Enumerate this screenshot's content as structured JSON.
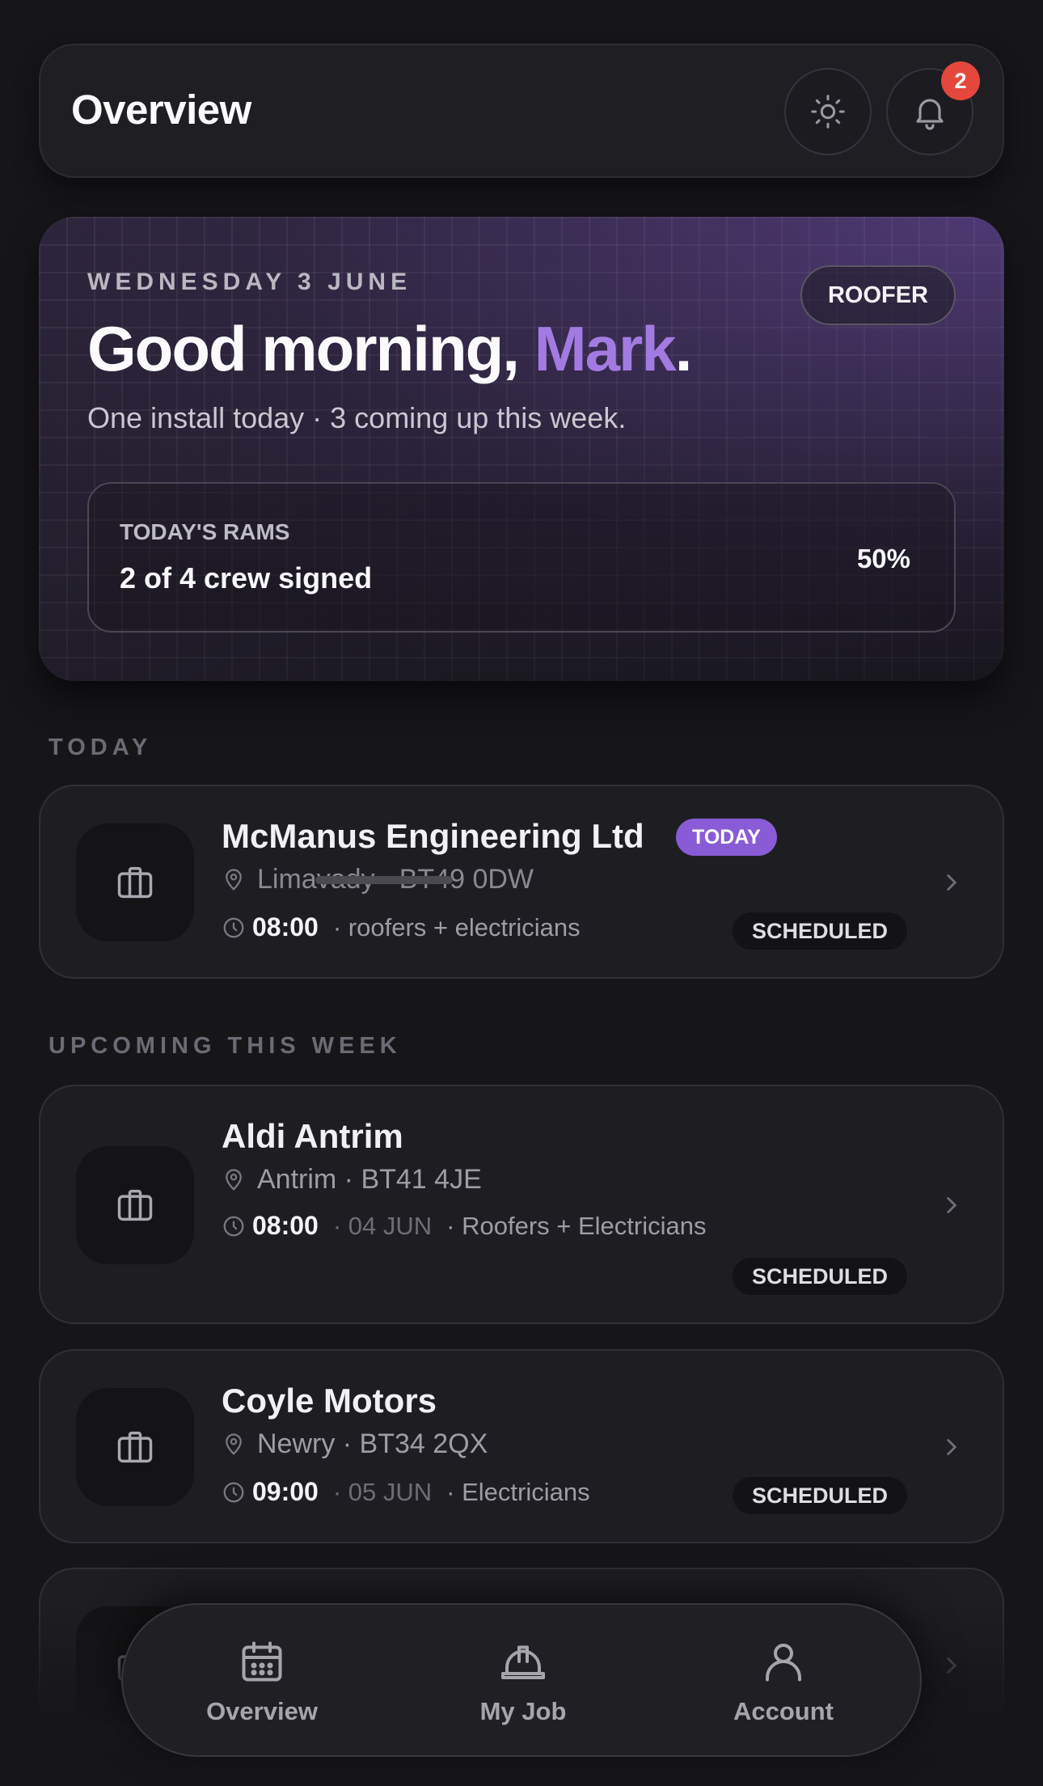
{
  "header": {
    "title": "Overview",
    "notification_count": "2",
    "icons": [
      "sun-icon",
      "bell-icon"
    ]
  },
  "hero": {
    "date": "WEDNESDAY 3 JUNE",
    "role": "ROOFER",
    "greeting_prefix": "Good morning, ",
    "name": "Mark",
    "greeting_suffix": ".",
    "summary": "One install today · 3 coming up this week.",
    "rams": {
      "label": "TODAY'S RAMS",
      "status": "2 of 4 crew signed",
      "percent": "50%"
    },
    "accent_color": "#a27be2"
  },
  "sections": {
    "today": "TODAY",
    "upcoming": "UPCOMING THIS WEEK"
  },
  "jobs": {
    "today": [
      {
        "name": "McManus Engineering Ltd",
        "pill": "TODAY",
        "location": "Limavady · BT49 0DW",
        "time": "08:00",
        "trades": "· roofers + electricians",
        "status": "SCHEDULED"
      }
    ],
    "upcoming": [
      {
        "name": "Aldi Antrim",
        "location": "Antrim · BT41 4JE",
        "time": "08:00",
        "date": "· 04 JUN",
        "trades": "· Roofers + Electricians",
        "status": "SCHEDULED"
      },
      {
        "name": "Coyle Motors",
        "location": "Newry · BT34 2QX",
        "time": "09:00",
        "date": "· 05 JUN",
        "trades": "· Electricians",
        "status": "SCHEDULED"
      }
    ]
  },
  "nav": {
    "items": [
      {
        "label": "Overview",
        "icon": "calendar-icon"
      },
      {
        "label": "My Job",
        "icon": "hard-hat-icon"
      },
      {
        "label": "Account",
        "icon": "user-icon"
      }
    ]
  }
}
